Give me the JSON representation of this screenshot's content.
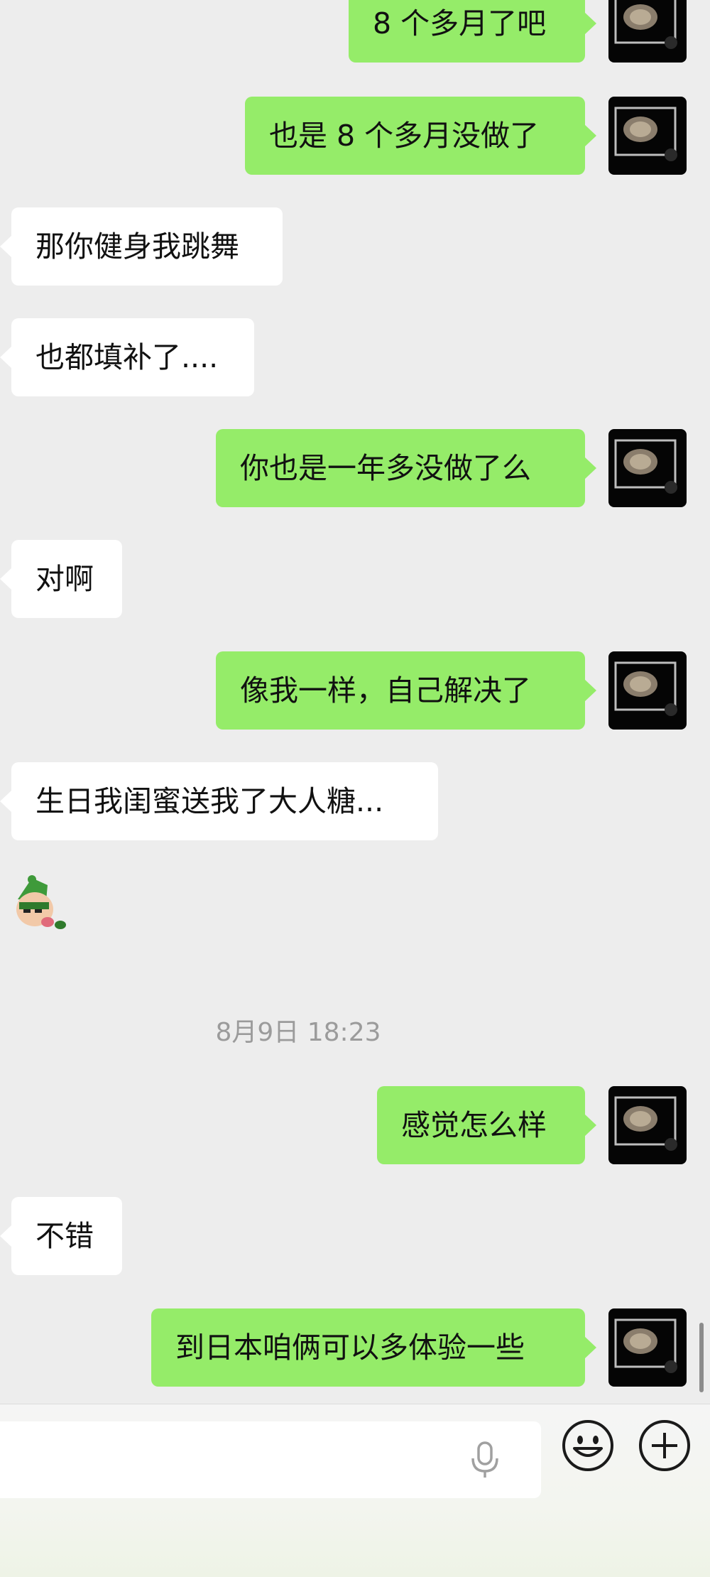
{
  "messages": [
    {
      "text": "8 个多月了吧"
    },
    {
      "text": "也是 8 个多月没做了"
    },
    {
      "text": "那你健身我跳舞"
    },
    {
      "text": "也都填补了...."
    },
    {
      "text": "你也是一年多没做了么"
    },
    {
      "text": "对啊"
    },
    {
      "text": "像我一样，自己解决了"
    },
    {
      "text": "生日我闺蜜送我了大人糖..."
    },
    {
      "text": "感觉怎么样"
    },
    {
      "text": "不错"
    },
    {
      "text": "到日本咱俩可以多体验一些"
    }
  ],
  "timestamp": "8月9日 18:23",
  "sticker": {
    "icon": "cartoon-sticker-icon"
  },
  "input": {
    "value": ""
  },
  "icons": {
    "voice": "microphone-icon",
    "emoji": "smiley-icon",
    "more": "plus-icon"
  },
  "colors": {
    "outgoing_bubble": "#95ec69",
    "incoming_bubble": "#ffffff",
    "background": "#ededed"
  }
}
